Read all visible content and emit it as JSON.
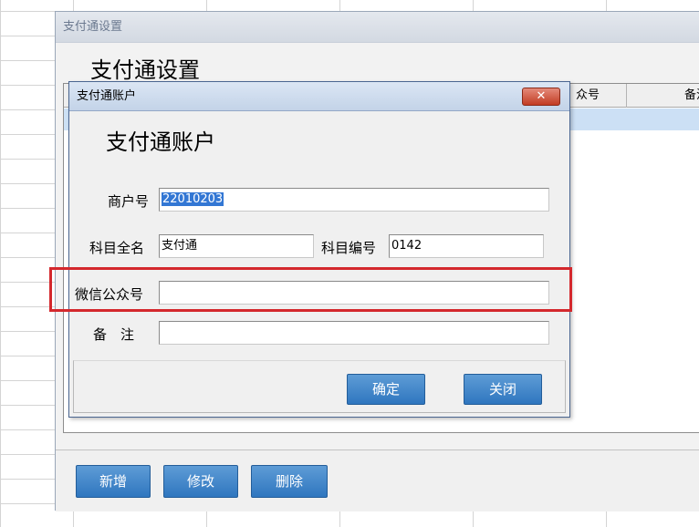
{
  "outer_window": {
    "title": "支付通设置",
    "heading": "支付通设置",
    "columns": [
      "众号",
      "备注"
    ],
    "buttons": {
      "add": "新增",
      "edit": "修改",
      "delete": "删除"
    }
  },
  "dialog": {
    "title": "支付通账户",
    "close_icon": "close-x-icon",
    "close_glyph": "✕",
    "heading": "支付通账户",
    "fields": {
      "merchant_id": {
        "label": "商户号",
        "value": "22010203"
      },
      "subject_name": {
        "label": "科目全名",
        "value": "支付通"
      },
      "subject_code": {
        "label": "科目编号",
        "value": "0142"
      },
      "wechat_account": {
        "label": "微信公众号",
        "value": ""
      },
      "remark": {
        "label": "备　注",
        "value": ""
      }
    },
    "buttons": {
      "confirm": "确定",
      "close": "关闭"
    }
  },
  "colors": {
    "button_blue": "#2f76bf",
    "highlight_red": "#d4282d",
    "selection_blue": "#3377d4"
  }
}
